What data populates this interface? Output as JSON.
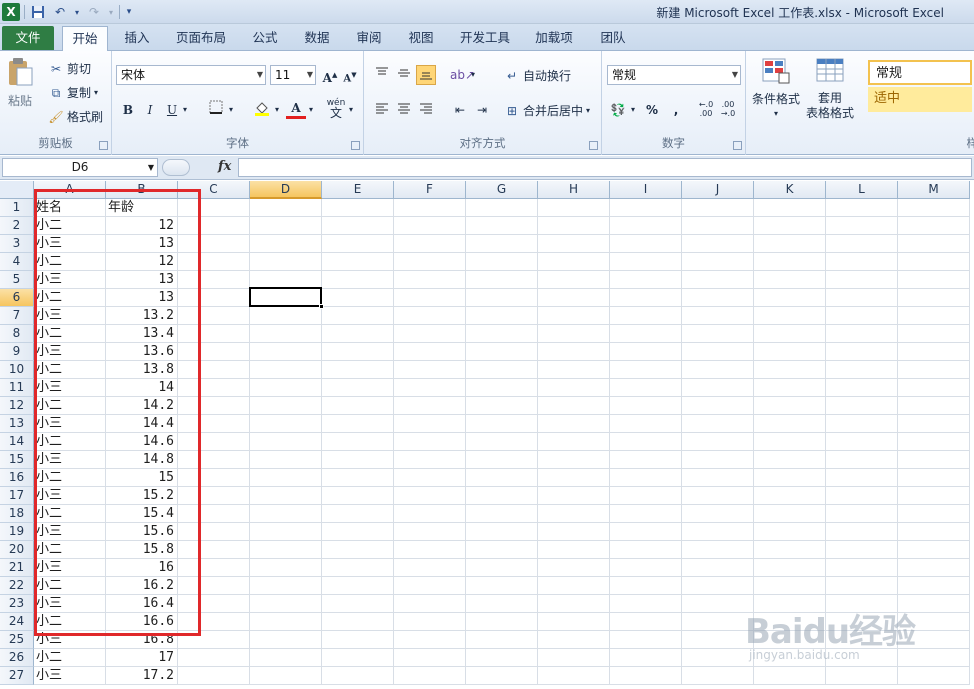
{
  "title_bar": {
    "app_logo": "X",
    "title": "新建 Microsoft Excel 工作表.xlsx  -  Microsoft Excel"
  },
  "ribbon_tabs": {
    "file": "文件",
    "items": [
      "开始",
      "插入",
      "页面布局",
      "公式",
      "数据",
      "审阅",
      "视图",
      "开发工具",
      "加载项",
      "团队"
    ],
    "active": "开始"
  },
  "clipboard": {
    "paste": "粘贴",
    "cut": "剪切",
    "copy": "复制",
    "format_painter": "格式刷",
    "label": "剪贴板"
  },
  "font": {
    "name": "宋体",
    "size": "11",
    "grow": "A",
    "shrink": "A",
    "bold": "B",
    "italic": "I",
    "underline": "U",
    "font_color": "A",
    "phonetic": "wén",
    "label": "字体"
  },
  "alignment": {
    "wrap_text": "自动换行",
    "merge_center": "合并后居中",
    "label": "对齐方式"
  },
  "number": {
    "format": "常规",
    "percent": "%",
    "comma": ",",
    "label": "数字"
  },
  "styles": {
    "conditional": "条件格式",
    "table_format_1": "套用",
    "table_format_2": "表格格式",
    "normal": "常规",
    "neutral": "适中",
    "cut_off_label": "样"
  },
  "formula_bar": {
    "name_box": "D6",
    "fx": "fx",
    "value": ""
  },
  "sheet": {
    "columns": [
      "A",
      "B",
      "C",
      "D",
      "E",
      "F",
      "G",
      "H",
      "I",
      "J",
      "K",
      "L",
      "M"
    ],
    "selected_column": "D",
    "selected_row": 6,
    "rows": [
      {
        "n": "1",
        "a": "姓名",
        "b": "年龄"
      },
      {
        "n": "2",
        "a": "小二",
        "b": "12"
      },
      {
        "n": "3",
        "a": "小三",
        "b": "13"
      },
      {
        "n": "4",
        "a": "小二",
        "b": "12"
      },
      {
        "n": "5",
        "a": "小三",
        "b": "13"
      },
      {
        "n": "6",
        "a": "小二",
        "b": "13"
      },
      {
        "n": "7",
        "a": "小三",
        "b": "13.2"
      },
      {
        "n": "8",
        "a": "小二",
        "b": "13.4"
      },
      {
        "n": "9",
        "a": "小三",
        "b": "13.6"
      },
      {
        "n": "10",
        "a": "小二",
        "b": "13.8"
      },
      {
        "n": "11",
        "a": "小三",
        "b": "14"
      },
      {
        "n": "12",
        "a": "小二",
        "b": "14.2"
      },
      {
        "n": "13",
        "a": "小三",
        "b": "14.4"
      },
      {
        "n": "14",
        "a": "小二",
        "b": "14.6"
      },
      {
        "n": "15",
        "a": "小三",
        "b": "14.8"
      },
      {
        "n": "16",
        "a": "小二",
        "b": "15"
      },
      {
        "n": "17",
        "a": "小三",
        "b": "15.2"
      },
      {
        "n": "18",
        "a": "小二",
        "b": "15.4"
      },
      {
        "n": "19",
        "a": "小三",
        "b": "15.6"
      },
      {
        "n": "20",
        "a": "小二",
        "b": "15.8"
      },
      {
        "n": "21",
        "a": "小三",
        "b": "16"
      },
      {
        "n": "22",
        "a": "小二",
        "b": "16.2"
      },
      {
        "n": "23",
        "a": "小三",
        "b": "16.4"
      },
      {
        "n": "24",
        "a": "小二",
        "b": "16.6"
      },
      {
        "n": "25",
        "a": "小三",
        "b": "16.8"
      },
      {
        "n": "26",
        "a": "小二",
        "b": "17"
      },
      {
        "n": "27",
        "a": "小三",
        "b": "17.2"
      }
    ]
  },
  "watermark": {
    "logo": "Baidu经验",
    "url": "jingyan.baidu.com"
  },
  "colors": {
    "file_tab": "#2f7d44",
    "highlight": "#e0282a",
    "selected_header": "#f6c55f"
  }
}
